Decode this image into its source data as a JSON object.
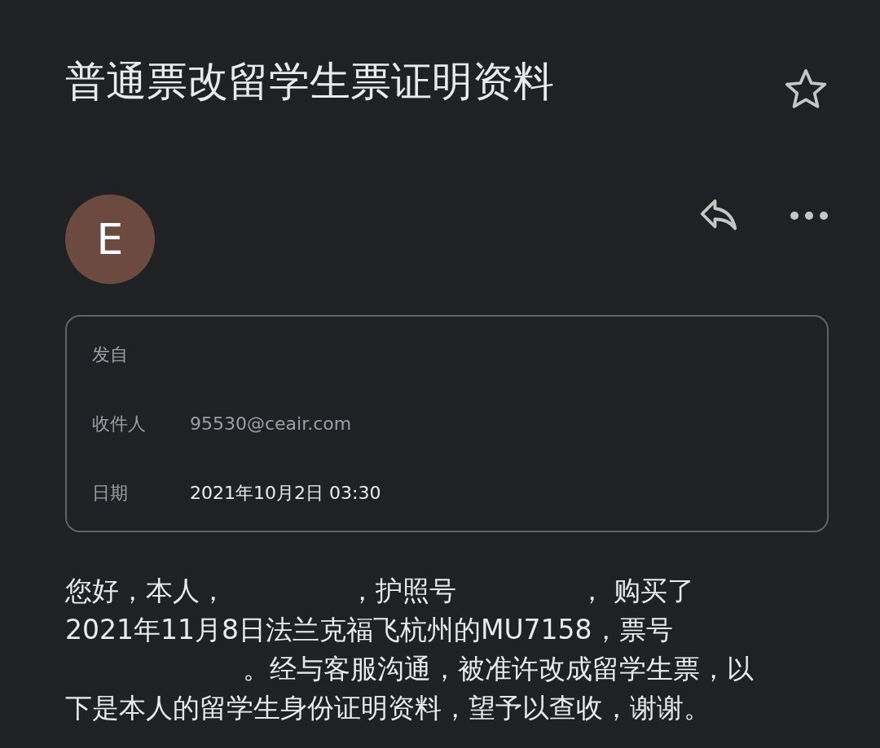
{
  "subject": "普通票改留学生票证明资料",
  "starred": false,
  "sender": {
    "initial": "E"
  },
  "details": [
    {
      "label": "发自"
    },
    {
      "label": "收件人",
      "value": "95530@ceair.com"
    },
    {
      "label": "日期",
      "value": "2021年10月2日 03:30"
    }
  ],
  "body": [
    [
      "您好，本人，",
      "，护照号",
      "， 购买了"
    ],
    [
      "2021年11月8日法兰克福飞杭州的MU7158，票号"
    ],
    [
      "。经与客服沟通，被准许改成留学生票，以"
    ],
    [
      "下是本人的留学生身份证明资料，望予以查收，谢谢。"
    ]
  ]
}
